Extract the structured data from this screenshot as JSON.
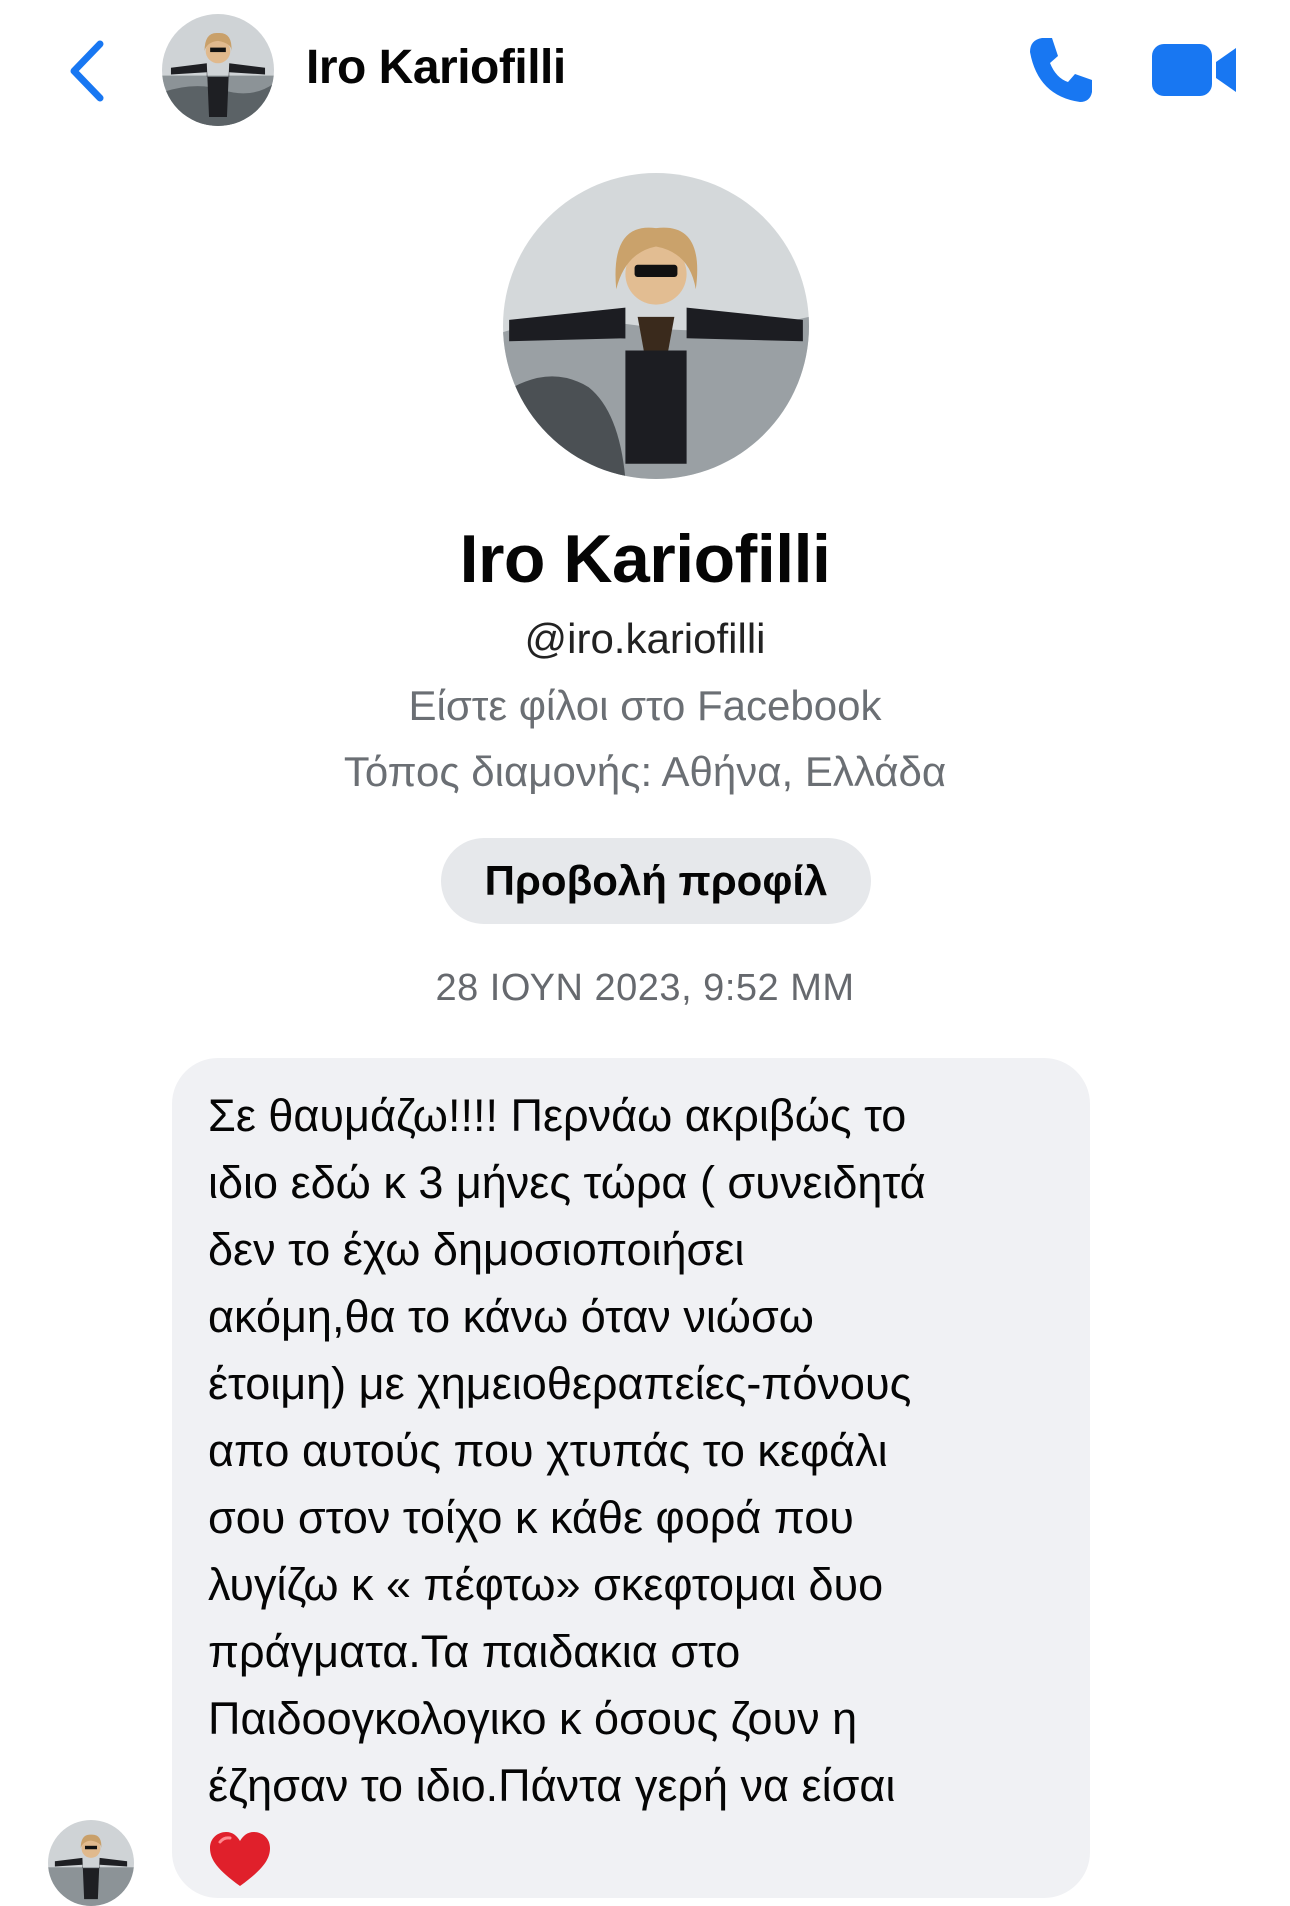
{
  "header": {
    "back_icon": "chevron-left-icon",
    "contact_name": "Iro Kariofilli",
    "call_icon": "phone-icon",
    "video_icon": "video-camera-icon",
    "accent_color": "#1877f2"
  },
  "profile": {
    "name": "Iro Kariofilli",
    "username": "@iro.kariofilli",
    "friends_text": "Είστε φίλοι στο Facebook",
    "location_text": "Τόπος διαμονής: Αθήνα, Ελλάδα",
    "view_profile_label": "Προβολή προφίλ"
  },
  "conversation": {
    "timestamp": "28 ΙΟΥΝ 2023, 9:52 ΜΜ",
    "message": {
      "lines": [
        "Σε θαυμάζω!!!! Περνάω ακριβώς το",
        "ιδιο εδώ κ 3 μήνες τώρα ( συνειδητά",
        "δεν το έχω δημοσιοποιήσει",
        "ακόμη,θα το κάνω όταν νιώσω",
        "έτοιμη) με χημειοθεραπείες-πόνους",
        "απο αυτούς που χτυπάς το κεφάλι",
        "σου στον τοίχο κ κάθε φορά που",
        "λυγίζω κ « πέφτω» σκεφτομαι δυο",
        "πράγματα.Τα παιδακια στο",
        "Παιδοογκολογικο κ όσους ζουν η",
        "έζησαν το ιδιο.Πάντα γερή να είσαι"
      ],
      "emoji_icon": "red-heart-icon"
    }
  }
}
